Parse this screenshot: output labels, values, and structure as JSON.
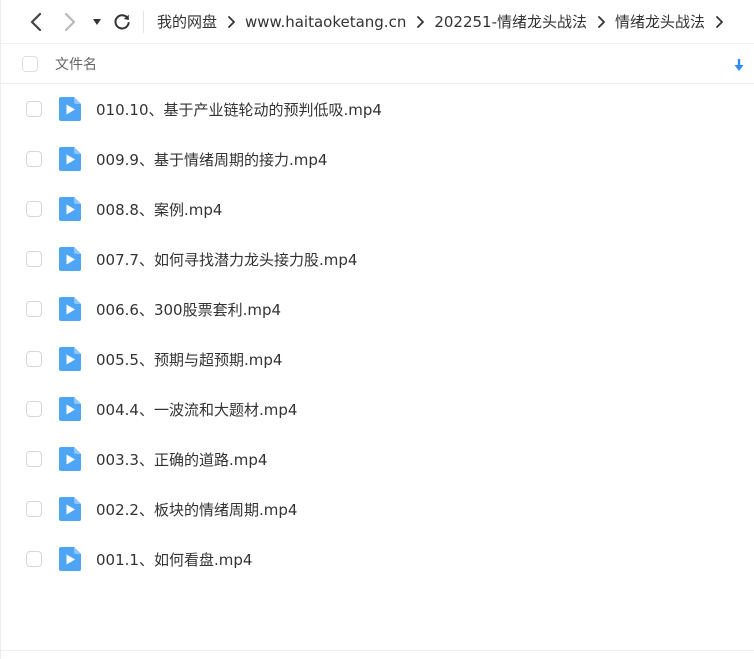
{
  "breadcrumb": [
    "我的网盘",
    "www.haitaoketang.cn",
    "202251-情绪龙头战法",
    "情绪龙头战法"
  ],
  "list_header": {
    "name_column": "文件名"
  },
  "files": [
    {
      "name": "010.10、基于产业链轮动的预判低吸.mp4",
      "type": "video"
    },
    {
      "name": "009.9、基于情绪周期的接力.mp4",
      "type": "video"
    },
    {
      "name": "008.8、案例.mp4",
      "type": "video"
    },
    {
      "name": "007.7、如何寻找潜力龙头接力股.mp4",
      "type": "video"
    },
    {
      "name": "006.6、300股票套利.mp4",
      "type": "video"
    },
    {
      "name": "005.5、预期与超预期.mp4",
      "type": "video"
    },
    {
      "name": "004.4、一波流和大题材.mp4",
      "type": "video"
    },
    {
      "name": "003.3、正确的道路.mp4",
      "type": "video"
    },
    {
      "name": "002.2、板块的情绪周期.mp4",
      "type": "video"
    },
    {
      "name": "001.1、如何看盘.mp4",
      "type": "video"
    }
  ],
  "icons": {
    "back": "chevron-left-icon",
    "forward": "chevron-right-icon",
    "dropdown": "caret-down-icon",
    "refresh": "refresh-icon",
    "sort": "sort-down-arrow-icon",
    "file": "video-file-icon"
  },
  "colors": {
    "accent": "#2f8cf0",
    "file_icon": "#4ea4f5",
    "text": "#333333",
    "muted": "#666666"
  }
}
